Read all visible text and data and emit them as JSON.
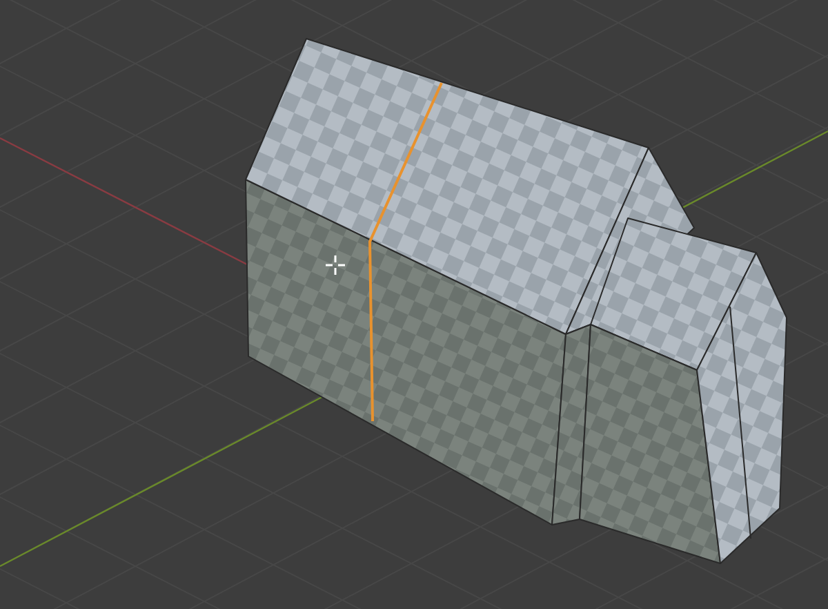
{
  "viewport": {
    "show_grid": true,
    "seam_selected": true,
    "cursor_visible": true
  }
}
